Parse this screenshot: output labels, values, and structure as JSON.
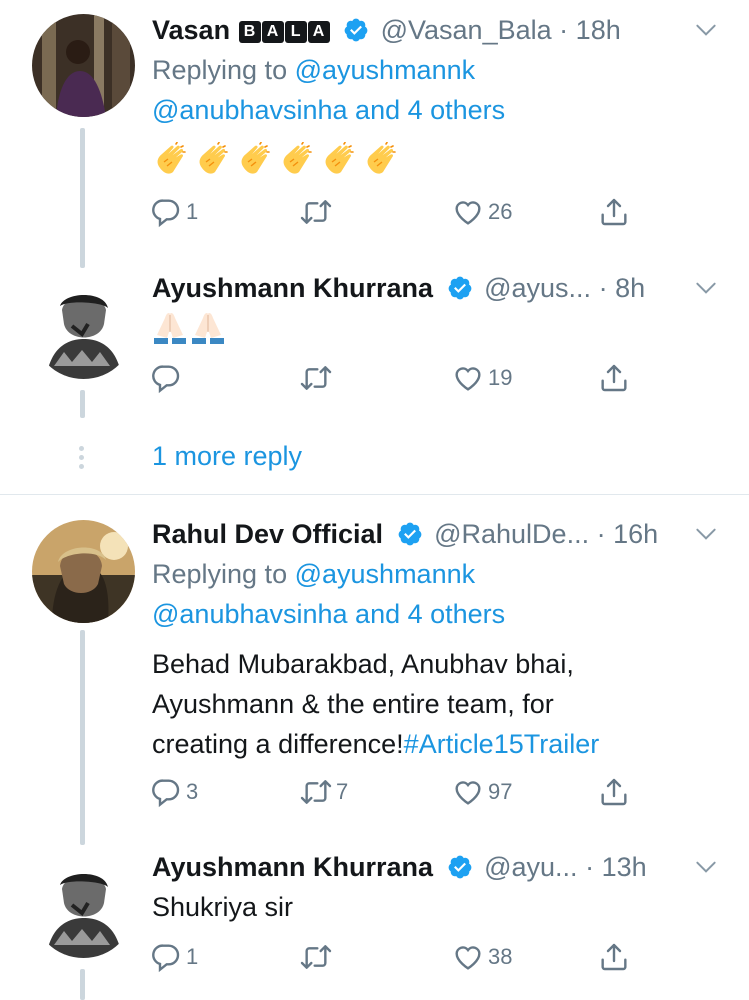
{
  "tweets": [
    {
      "name": "Vasan",
      "name_badges": [
        "B",
        "A",
        "L",
        "A"
      ],
      "handle": "@Vasan_Bala",
      "separator": "·",
      "time": "18h",
      "replying_prefix": "Replying to",
      "replying_user": "@ayushmannk",
      "replying_line2": "@anubhavsinha and 4 others",
      "emoji": "clapping-hands",
      "emoji_count": 6,
      "stats": {
        "replies": "1",
        "retweets": "",
        "likes": "26"
      }
    },
    {
      "name": "Ayushmann Khurrana",
      "handle": "@ayus...",
      "separator": "·",
      "time": "8h",
      "emoji": "folded-hands",
      "emoji_count": 2,
      "stats": {
        "replies": "",
        "retweets": "",
        "likes": "19"
      }
    },
    {
      "more_reply": "1 more reply"
    },
    {
      "name": "Rahul Dev Official",
      "handle": "@RahulDe...",
      "separator": "·",
      "time": "16h",
      "replying_prefix": "Replying to",
      "replying_user": "@ayushmannk",
      "replying_line2": "@anubhavsinha and 4 others",
      "body_line1": "Behad Mubarakbad, Anubhav bhai,",
      "body_line2": "Ayushmann & the entire team, for",
      "body_line3_text": "creating a difference!",
      "body_line3_hashtag": "#Article15Trailer",
      "stats": {
        "replies": "3",
        "retweets": "7",
        "likes": "97"
      }
    },
    {
      "name": "Ayushmann Khurrana",
      "handle": "@ayu...",
      "separator": "·",
      "time": "13h",
      "body": "Shukriya sir",
      "stats": {
        "replies": "1",
        "retweets": "",
        "likes": "38"
      }
    }
  ],
  "colors": {
    "link": "#1b95e0",
    "muted": "#657786",
    "verified": "#1da1f2",
    "line": "#ccd6dd",
    "emoji": "#ffcc4d"
  }
}
